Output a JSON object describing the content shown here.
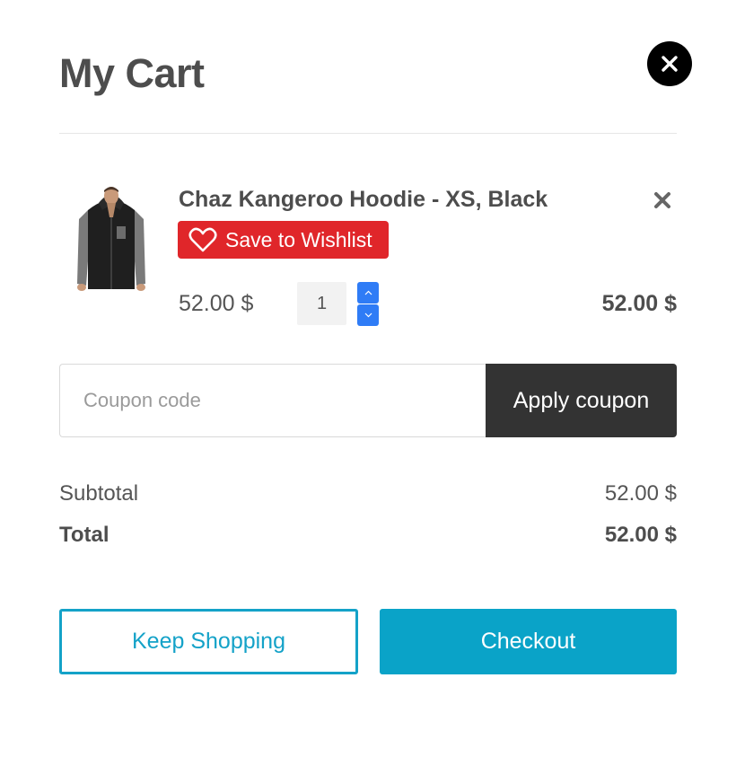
{
  "cart": {
    "title": "My Cart",
    "close_icon": "close-icon"
  },
  "item": {
    "name": "Chaz Kangeroo Hoodie - XS, Black",
    "thumbnail_icon": "hoodie-product-image",
    "remove_icon": "remove-x-icon",
    "wishlist_label": "Save to Wishlist",
    "wishlist_icon": "heart-outline-icon",
    "unit_price": "52.00 $",
    "quantity": "1",
    "line_total": "52.00 $"
  },
  "coupon": {
    "placeholder": "Coupon code",
    "value": "",
    "apply_label": "Apply coupon"
  },
  "summary": {
    "subtotal_label": "Subtotal",
    "subtotal_value": "52.00 $",
    "total_label": "Total",
    "total_value": "52.00 $"
  },
  "actions": {
    "keep_shopping_label": "Keep Shopping",
    "checkout_label": "Checkout"
  },
  "colors": {
    "wishlist_bg": "#e0262a",
    "stepper": "#2f7cf6",
    "accent": "#0aa3c8",
    "apply_bg": "#333333"
  }
}
